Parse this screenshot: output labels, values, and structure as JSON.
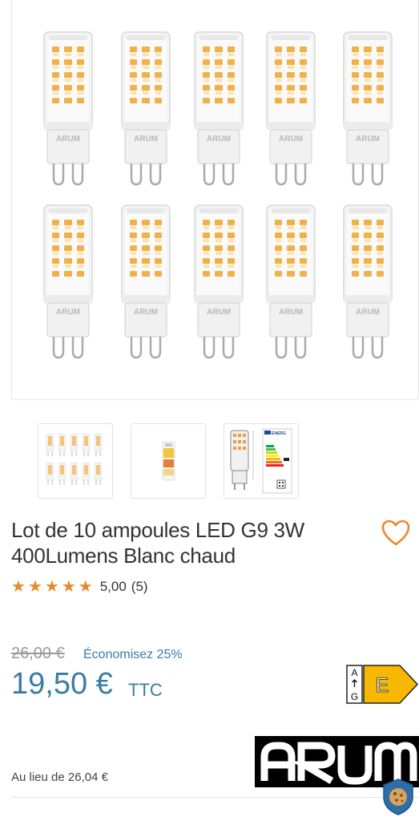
{
  "product": {
    "title": "Lot de 10 ampoules LED G9 3W 400Lumens Blanc chaud",
    "rating": {
      "stars": 5,
      "value": "5,00",
      "count": "(5)"
    },
    "old_price": "26,00 €",
    "saving": "Économisez 25%",
    "price": "19,50 €",
    "price_suffix": "TTC",
    "instead_of": "Au lieu de 26,04 €",
    "energy_label": {
      "top": "A",
      "bottom": "G",
      "class": "E",
      "color": "#f6b800"
    },
    "brand": "ARUM",
    "bulb_brand": "ARUM"
  },
  "gallery": {
    "thumbnails": [
      "lot-of-10-bulbs",
      "bulb-in-packaging",
      "energy-label-sheet"
    ],
    "thumb_energy_text": "ENERG"
  },
  "colors": {
    "accent": "#3a7ca5",
    "star": "#e8892a",
    "heart": "#e8892a"
  }
}
